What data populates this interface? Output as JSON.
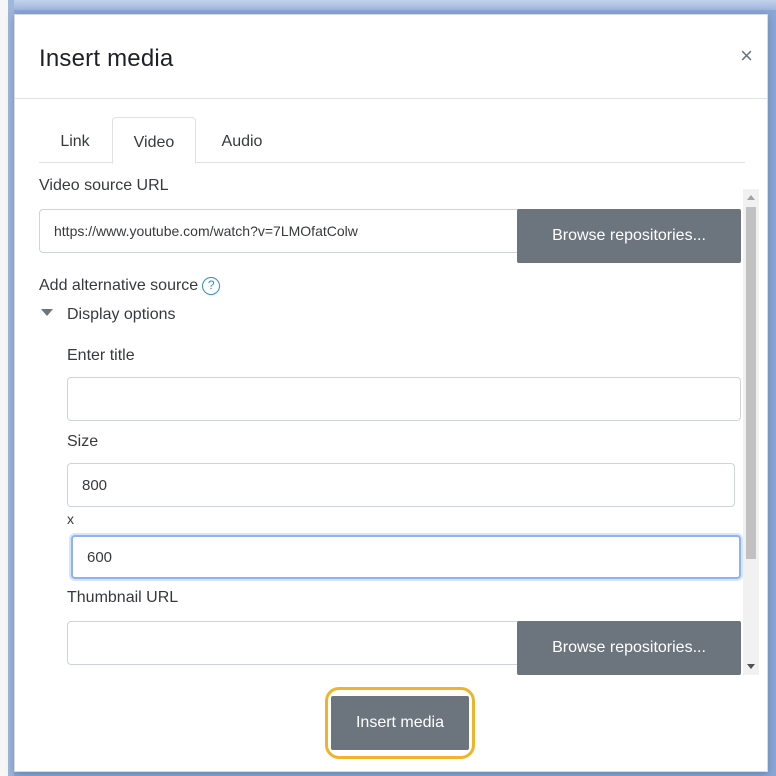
{
  "dialog": {
    "title": "Insert media",
    "close_label": "×"
  },
  "tabs": [
    {
      "label": "Link",
      "active": false
    },
    {
      "label": "Video",
      "active": true
    },
    {
      "label": "Audio",
      "active": false
    }
  ],
  "video": {
    "source_label": "Video source URL",
    "source_value": "https://www.youtube.com/watch?v=7LMOfatColw",
    "browse_label": "Browse repositories...",
    "alt_source_label": "Add alternative source",
    "help_icon": "?"
  },
  "display_options": {
    "toggle_label": "Display options",
    "title_label": "Enter title",
    "title_value": "",
    "size_label": "Size",
    "width_value": "800",
    "size_separator": "x",
    "height_value": "600",
    "thumbnail_label": "Thumbnail URL",
    "thumbnail_value": "",
    "thumbnail_browse_label": "Browse repositories..."
  },
  "footer": {
    "insert_label": "Insert media"
  },
  "colors": {
    "button_bg": "#6c757d",
    "highlight_ring": "#f0b429",
    "focus_border": "#8fb3f0",
    "help_icon": "#2c8fd0"
  }
}
